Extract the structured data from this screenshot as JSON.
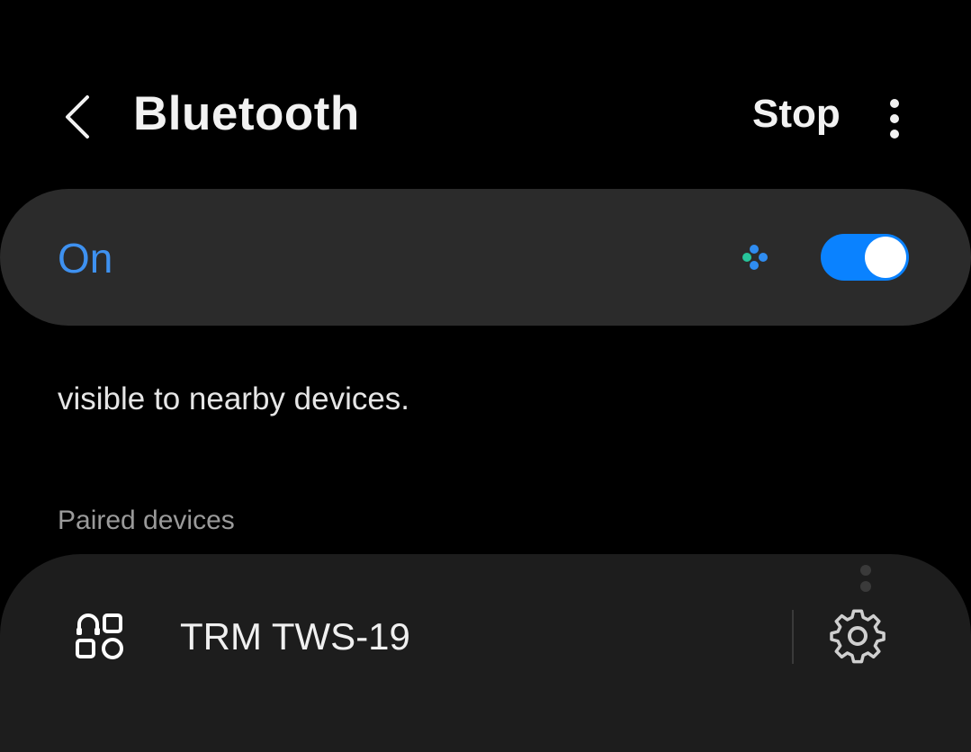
{
  "header": {
    "back_icon": "chevron-left-icon",
    "title": "Bluetooth",
    "stop_label": "Stop",
    "more_icon": "more-vertical-icon"
  },
  "main_switch": {
    "label": "On",
    "state": true,
    "scan_icon": "scanning-dots-icon",
    "accent_color": "#3e91f0",
    "toggle_color": "#0a82ff"
  },
  "visibility_text": "visible to nearby devices.",
  "paired_section": {
    "header": "Paired devices",
    "devices": [
      {
        "name": "TRM TWS-19",
        "icon": "headphones-device-icon",
        "settings_icon": "gear-icon"
      }
    ]
  }
}
